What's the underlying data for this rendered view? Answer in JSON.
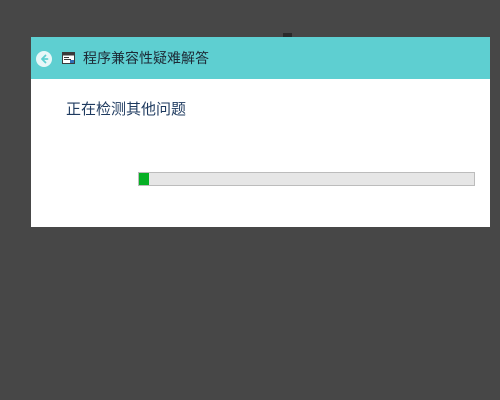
{
  "window": {
    "title": "程序兼容性疑难解答",
    "back_icon": "back-arrow-icon",
    "app_icon": "troubleshooter-icon"
  },
  "main": {
    "status_text": "正在检测其他问题",
    "progress": 0.03
  },
  "colors": {
    "titlebar": "#5ecfd1",
    "progress_fill": "#06b025",
    "progress_track": "#e6e6e6",
    "desktop_bg": "#474747",
    "status_text": "#1e3a5f"
  }
}
